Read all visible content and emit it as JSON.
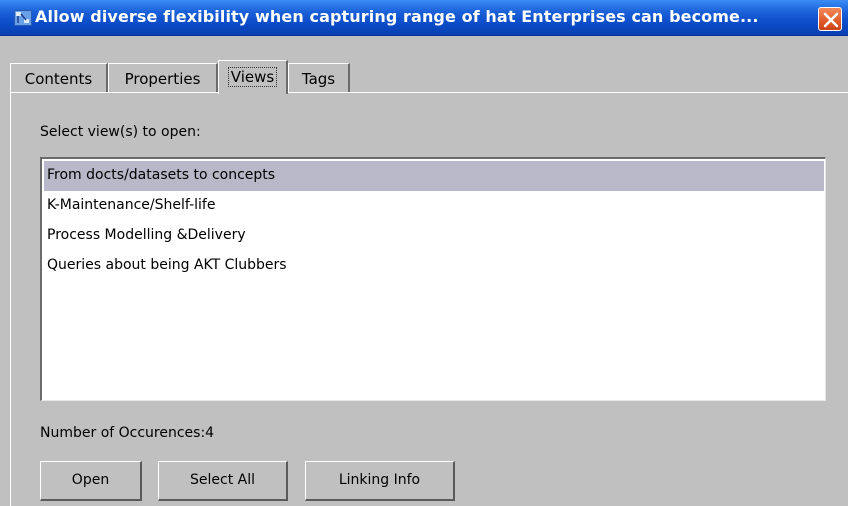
{
  "window": {
    "title": "Allow diverse flexibility when capturing range of hat Enterprises can become...",
    "icon": "app-window-icon",
    "close_icon": "close-icon"
  },
  "tabs": [
    {
      "label": "Contents",
      "active": false
    },
    {
      "label": "Properties",
      "active": false
    },
    {
      "label": "Views",
      "active": true
    },
    {
      "label": "Tags",
      "active": false
    }
  ],
  "views_panel": {
    "select_label": "Select view(s) to open:",
    "items": [
      {
        "label": "From docts/datasets to concepts",
        "selected": true
      },
      {
        "label": "K-Maintenance/Shelf-life",
        "selected": false
      },
      {
        "label": "Process Modelling &Delivery",
        "selected": false
      },
      {
        "label": "Queries about being AKT Clubbers",
        "selected": false
      }
    ],
    "occurrences_label": "Number of Occurences:4"
  },
  "buttons": {
    "open": "Open",
    "select_all": "Select All",
    "linking_info": "Linking Info"
  },
  "colors": {
    "title_bar": "#0a4ac6",
    "close_button": "#e05a2a",
    "panel_bg": "#c0c0c0",
    "selection": "#b8b8c8"
  }
}
